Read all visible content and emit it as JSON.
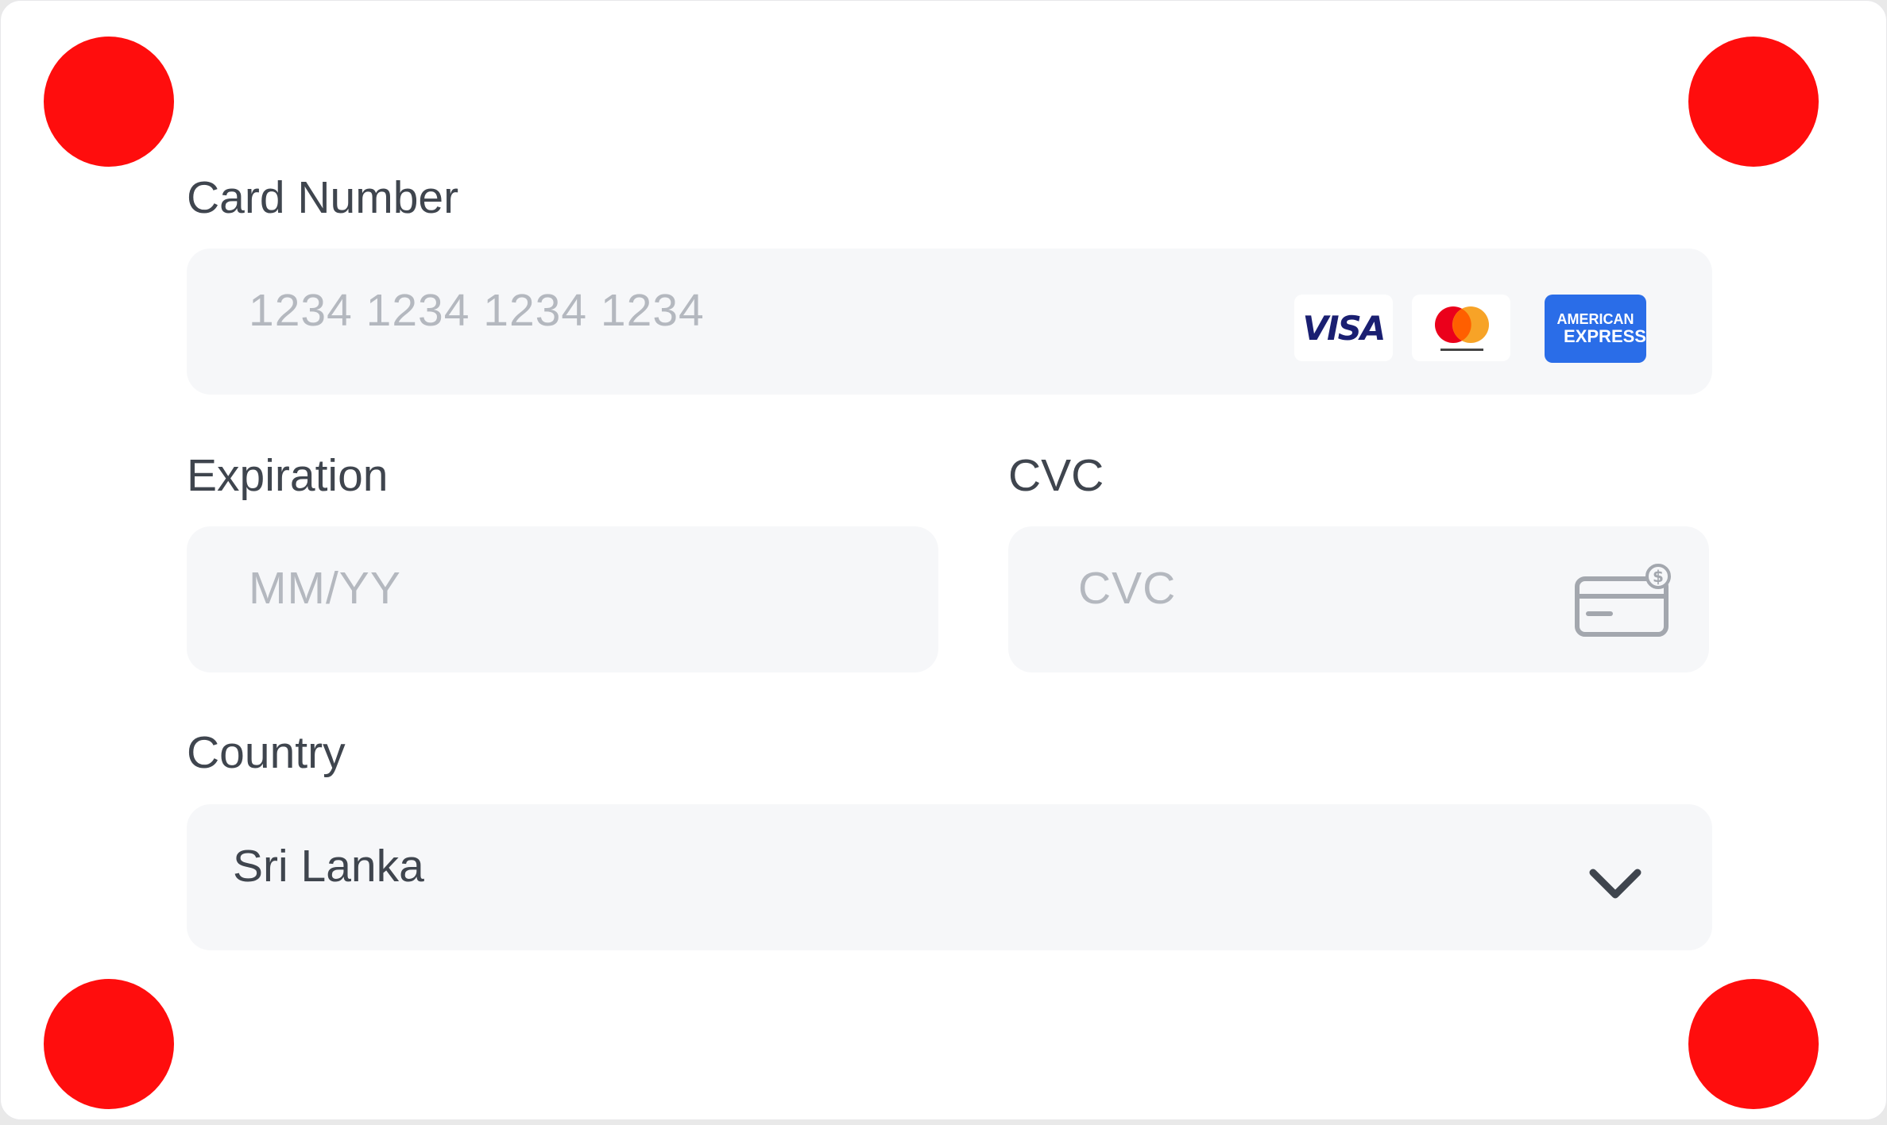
{
  "form": {
    "card_number": {
      "label": "Card Number",
      "placeholder": "1234  1234  1234  1234",
      "brands": [
        {
          "name": "visa",
          "text": "VISA"
        },
        {
          "name": "mastercard"
        },
        {
          "name": "amex",
          "line1": "AMERICAN",
          "line2": "EXPRESS"
        }
      ]
    },
    "expiration": {
      "label": "Expiration",
      "placeholder": "MM/YY"
    },
    "cvc": {
      "label": "CVC",
      "placeholder": "CVC",
      "icon": "card-cvc-icon"
    },
    "country": {
      "label": "Country",
      "value": "Sri Lanka",
      "icon": "chevron-down-icon"
    }
  },
  "colors": {
    "marker": "#ff0d0d",
    "field_bg": "#f6f7f9",
    "label": "#3f454e",
    "placeholder": "#b4b8bf",
    "amex": "#2a6de8",
    "visa": "#1a1f71",
    "mastercard_red": "#eb001b",
    "mastercard_orange": "#f79e1b"
  }
}
